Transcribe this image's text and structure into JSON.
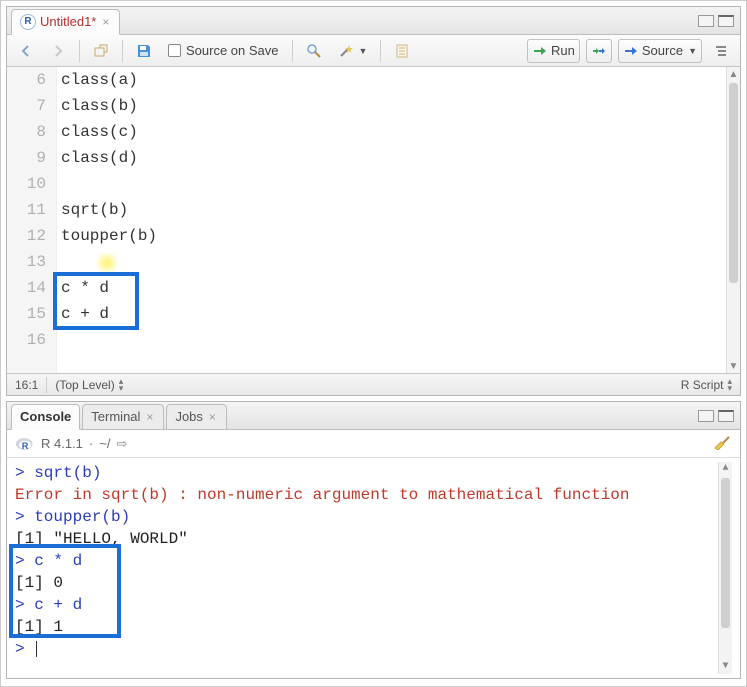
{
  "editor": {
    "filetab": {
      "name": "Untitled1*",
      "close": "×"
    },
    "toolbar": {
      "source_on_save": "Source on Save",
      "run": "Run",
      "source_btn": "Source"
    },
    "gutter_start": 6,
    "lines": [
      "class(a)",
      "class(b)",
      "class(c)",
      "class(d)",
      "",
      "sqrt(b)",
      "toupper(b)",
      "",
      "c * d",
      "c + d",
      ""
    ],
    "status": {
      "pos": "16:1",
      "scope": "(Top Level)",
      "filetype": "R Script"
    }
  },
  "console": {
    "tabs": {
      "console": "Console",
      "terminal": "Terminal",
      "jobs": "Jobs",
      "close": "×"
    },
    "info": {
      "version": "R 4.1.1",
      "dot": "·",
      "path": "~/"
    },
    "lines": [
      {
        "type": "cmd",
        "text": "sqrt(b)"
      },
      {
        "type": "err",
        "text": "Error in sqrt(b) : non-numeric argument to mathematical function"
      },
      {
        "type": "cmd",
        "text": "toupper(b)"
      },
      {
        "type": "out",
        "text": "[1] \"HELLO, WORLD\""
      },
      {
        "type": "cmd",
        "text": "c * d"
      },
      {
        "type": "out",
        "text": "[1] 0"
      },
      {
        "type": "cmd",
        "text": "c + d"
      },
      {
        "type": "out",
        "text": "[1] 1"
      }
    ],
    "prompt_char": ">"
  }
}
